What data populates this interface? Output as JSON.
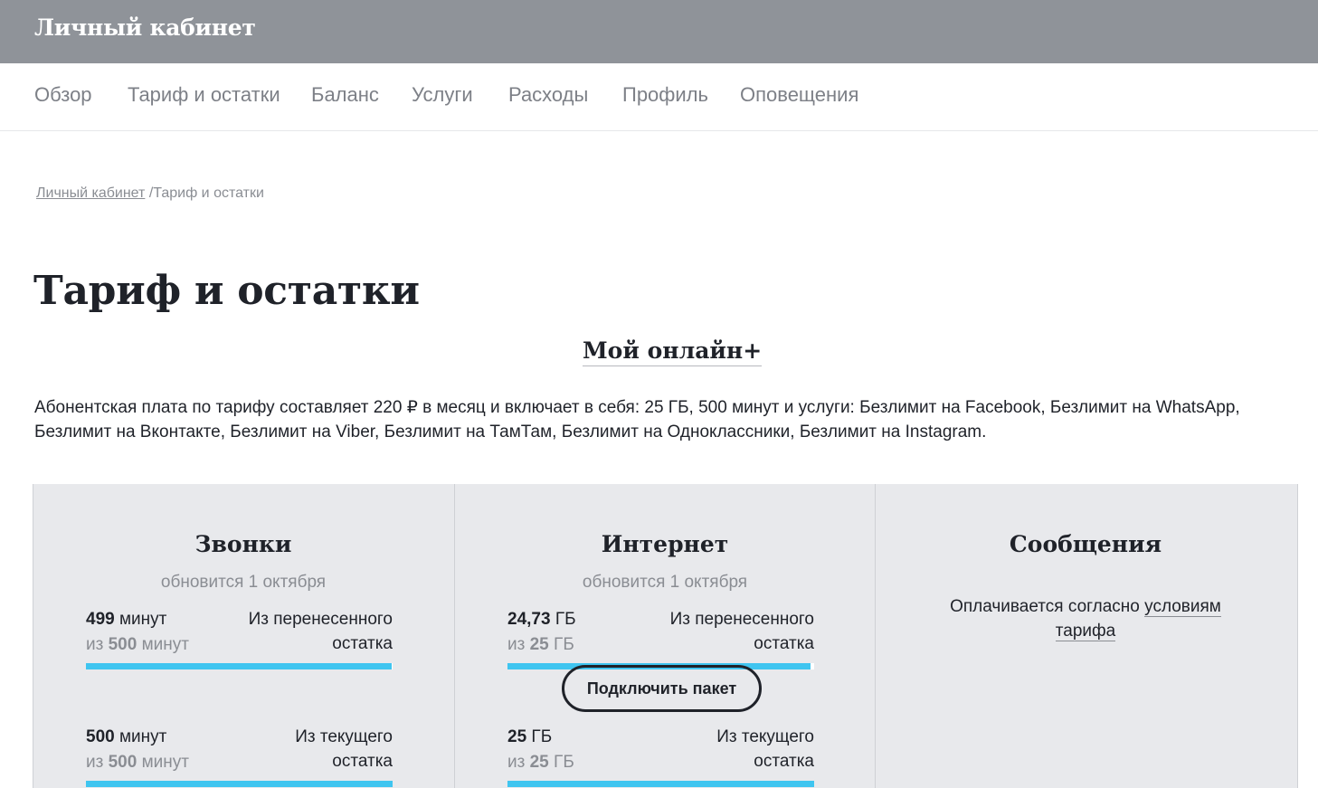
{
  "header": {
    "brand": "Личный кабинет"
  },
  "nav": {
    "items": [
      {
        "label": "Обзор"
      },
      {
        "label": "Тариф и остатки"
      },
      {
        "label": "Баланс"
      },
      {
        "label": "Услуги"
      },
      {
        "label": "Расходы"
      },
      {
        "label": "Профиль"
      },
      {
        "label": "Оповещения"
      }
    ]
  },
  "breadcrumb": {
    "root": "Личный кабинет",
    "separator": "/",
    "current": "Тариф и остатки"
  },
  "page": {
    "title": "Тариф и остатки",
    "tariff_name": "Мой онлайн+",
    "description": "Абонентская плата по тарифу составляет 220 ₽ в месяц и включает в себя: 25 ГБ, 500 минут и услуги: Безлимит на Facebook, Безлимит на WhatsApp, Безлимит на Вконтакте, Безлимит на Viber, Безлимит на ТамТам, Безлимит на Одноклассники, Безлимит на Instagram."
  },
  "cards": {
    "calls": {
      "title": "Звонки",
      "subtitle": "обновится 1 октября",
      "rows": [
        {
          "amount": "499",
          "unit": "минут",
          "total_prefix": "из",
          "total": "500",
          "total_unit": "минут",
          "source_line1": "Из перенесенного",
          "source_line2": "остатка",
          "fraction": 0.998
        },
        {
          "amount": "500",
          "unit": "минут",
          "total_prefix": "из",
          "total": "500",
          "total_unit": "минут",
          "source_line1": "Из текущего",
          "source_line2": "остатка",
          "fraction": 1.0
        }
      ]
    },
    "internet": {
      "title": "Интернет",
      "subtitle": "обновится 1 октября",
      "rows": [
        {
          "amount": "24,73",
          "unit": "ГБ",
          "total_prefix": "из",
          "total": "25",
          "total_unit": "ГБ",
          "source_line1": "Из перенесенного",
          "source_line2": "остатка",
          "fraction": 0.9892
        },
        {
          "amount": "25",
          "unit": "ГБ",
          "total_prefix": "из",
          "total": "25",
          "total_unit": "ГБ",
          "source_line1": "Из текущего",
          "source_line2": "остатка",
          "fraction": 1.0
        }
      ]
    },
    "messages": {
      "title": "Сообщения",
      "text_before": "Оплачивается согласно",
      "link_line1": "условиям",
      "link_line2": "тарифа",
      "button": "Подключить пакет"
    }
  },
  "colors": {
    "header_bg": "#8f9399",
    "accent_bar": "#3fc5f0",
    "card_bg": "#e8e9ec",
    "text": "#1f2229",
    "muted": "#8a8d93"
  }
}
